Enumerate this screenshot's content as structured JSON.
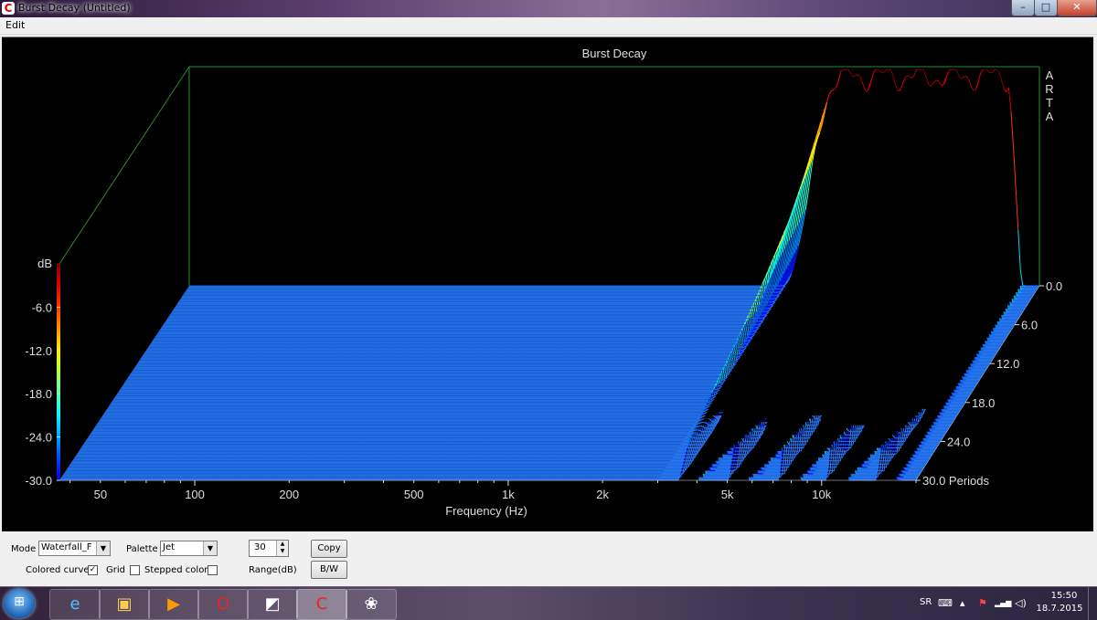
{
  "window": {
    "title": "Burst Decay  (Untitled)",
    "app_icon": "C",
    "min_glyph": "–",
    "max_glyph": "□",
    "close_glyph": "✕"
  },
  "menu": {
    "edit_label": "Edit"
  },
  "plot": {
    "title": "Burst Decay",
    "brand_letters": [
      "A",
      "R",
      "T",
      "A"
    ],
    "zlabel": "dB",
    "z_ticks": [
      "-6.0",
      "-12.0",
      "-18.0",
      "-24.0",
      "-30.0"
    ],
    "z_tick_values": [
      -6,
      -12,
      -18,
      -24,
      -30
    ],
    "x_ticks": [
      "50",
      "100",
      "200",
      "500",
      "1k",
      "2k",
      "5k",
      "10k"
    ],
    "x_tick_values": [
      50,
      100,
      200,
      500,
      1000,
      2000,
      5000,
      10000
    ],
    "xlabel": "Frequency (Hz)",
    "depth_ticks": [
      "0.0",
      "6.0",
      "12.0",
      "18.0",
      "24.0",
      "30.0 Periods"
    ],
    "depth_tick_values": [
      0,
      6,
      12,
      18,
      24,
      30
    ],
    "xlim": [
      37,
      20000
    ],
    "zlim": [
      -30,
      0
    ],
    "periods_range": [
      0,
      30
    ],
    "palette": "jet",
    "floor_color": "#1f6de0",
    "frame_color": "#1e8f2e",
    "text_color": "#dddddd"
  },
  "controls": {
    "mode_label": "Mode",
    "mode_value": "Waterfall_F",
    "palette_label": "Palette",
    "palette_value": "Jet",
    "range_value": "30",
    "range_label": "Range(dB)",
    "copy_label": "Copy",
    "bw_label": "B/W",
    "colored_curves_label": "Colored curves",
    "colored_curves_checked": true,
    "grid_label": "Grid",
    "grid_checked": false,
    "stepped_colors_label": "Stepped colors",
    "stepped_colors_checked": false,
    "check_glyph": "✓",
    "arrow_glyph": "▼"
  },
  "taskbar": {
    "start_glyph": "⊞",
    "apps": [
      {
        "icon": "e",
        "name": "internet-explorer"
      },
      {
        "icon": "▣",
        "name": "file-explorer"
      },
      {
        "icon": "▶",
        "name": "media-player"
      },
      {
        "icon": "O",
        "name": "opera"
      },
      {
        "icon": "◩",
        "name": "notes"
      },
      {
        "icon": "C",
        "name": "arta"
      },
      {
        "icon": "❀",
        "name": "paint"
      }
    ],
    "language": "SR",
    "tray_keyboard": "⌨",
    "tray_flag": "⚑",
    "tray_network": "▂▄▆",
    "tray_volume": "◁)",
    "tray_expand": "▴",
    "time": "15:50",
    "date": "18.7.2015"
  }
}
